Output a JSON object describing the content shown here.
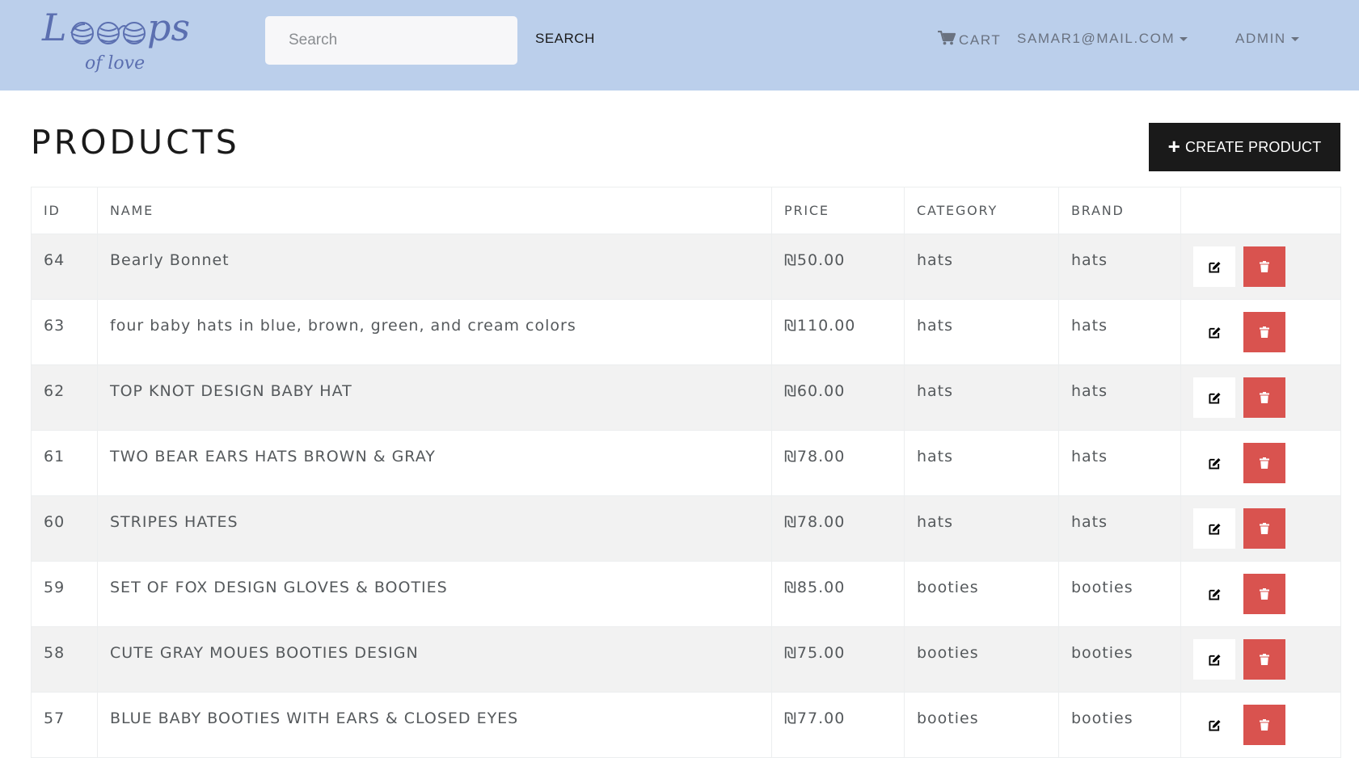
{
  "brand": {
    "logo_word": "Loops",
    "logo_tagline": "of love",
    "logo_color": "#5b6fb0"
  },
  "search": {
    "placeholder": "Search",
    "button_label": "SEARCH"
  },
  "nav": {
    "cart_label": "CART",
    "user_label": "SAMAR1@MAIL.COM",
    "admin_label": "ADMIN"
  },
  "page": {
    "title": "PRODUCTS",
    "create_label": "CREATE PRODUCT"
  },
  "table": {
    "columns": [
      "ID",
      "NAME",
      "PRICE",
      "CATEGORY",
      "BRAND",
      ""
    ],
    "rows": [
      {
        "id": "64",
        "name": "Bearly Bonnet",
        "price": "₪50.00",
        "category": "hats",
        "brand": "hats"
      },
      {
        "id": "63",
        "name": "four baby hats in blue, brown, green, and cream colors",
        "price": "₪110.00",
        "category": "hats",
        "brand": "hats"
      },
      {
        "id": "62",
        "name": "TOP KNOT DESIGN BABY HAT",
        "price": "₪60.00",
        "category": "hats",
        "brand": "hats"
      },
      {
        "id": "61",
        "name": "TWO BEAR EARS HATS BROWN & GRAY",
        "price": "₪78.00",
        "category": "hats",
        "brand": "hats"
      },
      {
        "id": "60",
        "name": "STRIPES HATES",
        "price": "₪78.00",
        "category": "hats",
        "brand": "hats"
      },
      {
        "id": "59",
        "name": "SET OF FOX DESIGN GLOVES & BOOTIES",
        "price": "₪85.00",
        "category": "booties",
        "brand": "booties"
      },
      {
        "id": "58",
        "name": "CUTE GRAY MOUES BOOTIES DESIGN",
        "price": "₪75.00",
        "category": "booties",
        "brand": "booties"
      },
      {
        "id": "57",
        "name": "BLUE BABY BOOTIES WITH EARS & CLOSED EYES",
        "price": "₪77.00",
        "category": "booties",
        "brand": "booties"
      }
    ]
  },
  "colors": {
    "navbar_bg": "#bbcfeb",
    "delete_button": "#d9534f",
    "create_button": "#1a1a1a",
    "row_stripe": "#f2f2f2"
  },
  "icons": {
    "cart": "cart-icon",
    "edit": "edit-icon",
    "delete": "trash-icon",
    "create": "plus-icon"
  }
}
